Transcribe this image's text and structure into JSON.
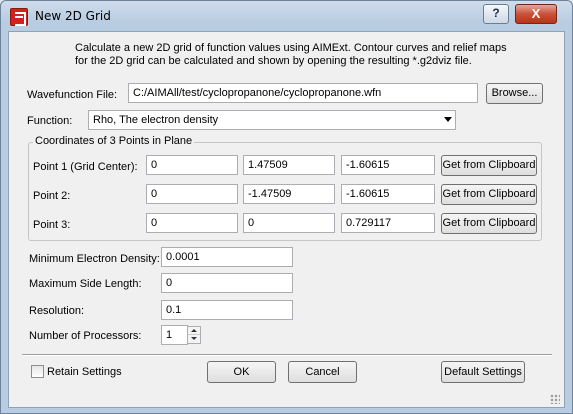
{
  "window": {
    "title": "New 2D Grid",
    "help_glyph": "?",
    "close_glyph": "X"
  },
  "intro": "Calculate a new 2D grid of function values using AIMExt.  Contour curves and relief maps for the 2D grid can be calculated and shown by opening the resulting *.g2dviz file.",
  "wavefunction": {
    "label": "Wavefunction File:",
    "value": "C:/AIMAll/test/cyclopropanone/cyclopropanone.wfn",
    "browse_label": "Browse..."
  },
  "function": {
    "label": "Function:",
    "selected": "Rho, The electron density"
  },
  "points_group": {
    "title": "Coordinates of 3 Points in Plane",
    "clipboard_label": "Get from Clipboard",
    "rows": [
      {
        "label": "Point 1 (Grid Center):",
        "x": "0",
        "y": "1.47509",
        "z": "-1.60615"
      },
      {
        "label": "Point 2:",
        "x": "0",
        "y": "-1.47509",
        "z": "-1.60615"
      },
      {
        "label": "Point 3:",
        "x": "0",
        "y": "0",
        "z": "0.729117"
      }
    ]
  },
  "params": {
    "min_density_label": "Minimum Electron Density:",
    "min_density": "0.0001",
    "max_side_label": "Maximum Side Length:",
    "max_side": "0",
    "resolution_label": "Resolution:",
    "resolution": "0.1",
    "processors_label": "Number of Processors:",
    "processors": "1"
  },
  "footer": {
    "retain_label": "Retain Settings",
    "ok_label": "OK",
    "cancel_label": "Cancel",
    "default_label": "Default Settings"
  }
}
